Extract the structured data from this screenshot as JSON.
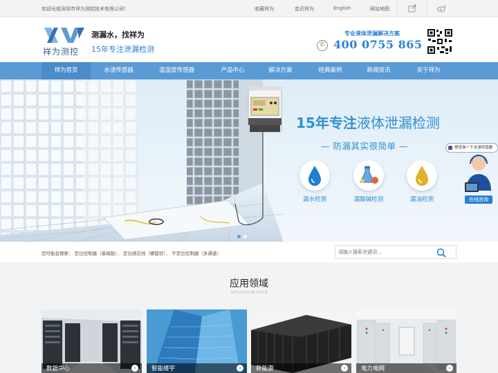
{
  "topbar": {
    "welcome": "欢迎光临深圳市祥为测控技术有限公司！",
    "links": [
      "收藏祥为",
      "走近祥为",
      "English",
      "网站地图"
    ],
    "icons": [
      "share-icon",
      "weibo-icon"
    ]
  },
  "header": {
    "logo_name": "祥为测控",
    "slogan_main": "测漏水，找祥为",
    "slogan_sub": "15年专注泄漏检测",
    "hotline_title": "专业液体泄漏解决方案",
    "hotline_phone": "400 0755 865"
  },
  "nav": {
    "items": [
      "祥为首页",
      "水浸传感器",
      "温湿度传感器",
      "产品中心",
      "解决方案",
      "经典案例",
      "新闻资讯",
      "关于祥为"
    ],
    "active_index": 0
  },
  "banner": {
    "title_bold": "15年专注",
    "title_rest": "液体泄漏检测",
    "subtitle": "— 防漏其实很简单 —",
    "features": [
      {
        "label": "漏水检测",
        "icon": "water-drop-icon"
      },
      {
        "label": "漏酸碱检测",
        "icon": "flask-icon"
      },
      {
        "label": "漏油检测",
        "icon": "oil-drop-icon"
      }
    ],
    "slides": 2,
    "active_slide": 1
  },
  "consult": {
    "bubble": "想咨询一下水浸传感器",
    "button": "在线咨询"
  },
  "search": {
    "hot_label": "您可能会搜索：",
    "hot_terms": "定位控制器（基础版）、 定位感应线（螺旋状）、 不定位控制器（多通道）",
    "placeholder": "请输入搜索关键词..."
  },
  "applications": {
    "title": "应用领域",
    "subtitle": "APPLICATION FIELD",
    "items": [
      {
        "label": "数据中心"
      },
      {
        "label": "智能楼宇"
      },
      {
        "label": "新能源"
      },
      {
        "label": "电力电网"
      }
    ]
  },
  "colors": {
    "brand_blue": "#2b7fd6",
    "nav_blue": "#5b9bd5"
  }
}
